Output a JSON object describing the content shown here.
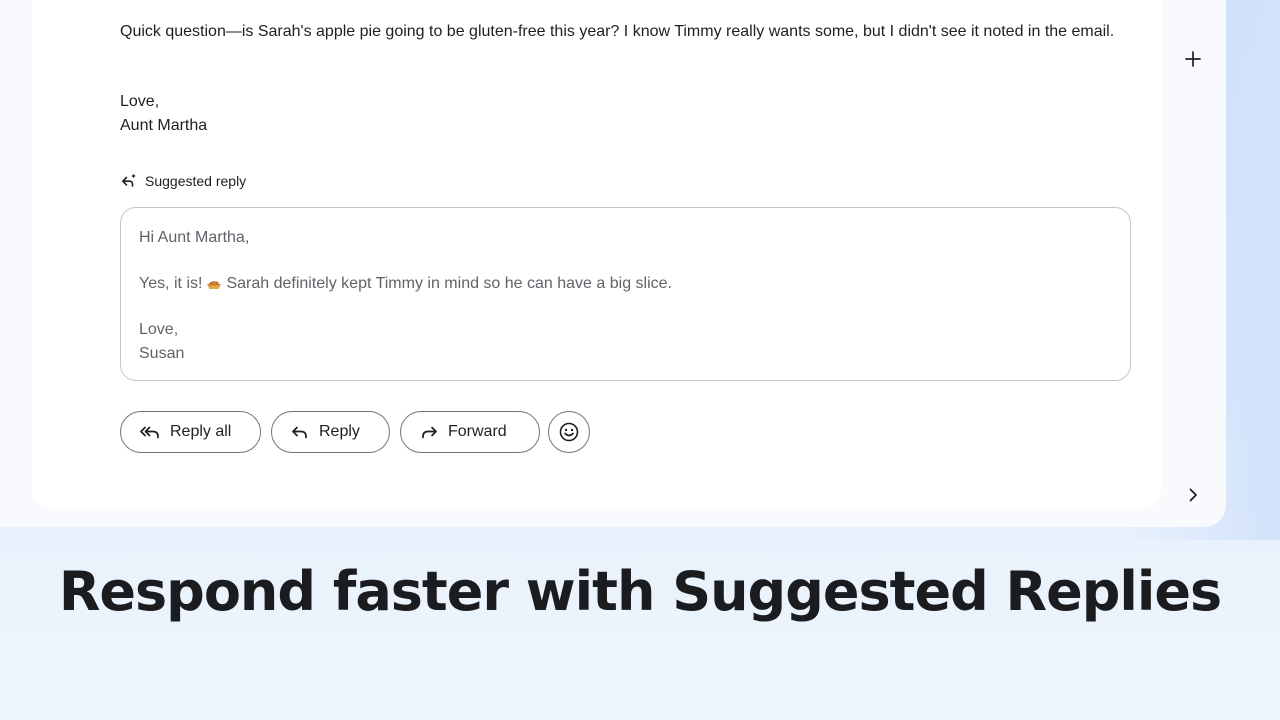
{
  "email": {
    "body_question": "Quick question—is Sarah's apple pie going to be gluten-free this year? I know Timmy really wants some, but I didn't see it noted in the email.",
    "closing": "Love,",
    "signature": "Aunt Martha"
  },
  "suggested_reply": {
    "label": "Suggested reply",
    "label_icon": "sparkle-reply-icon",
    "greeting": "Hi Aunt Martha,",
    "body_before_emoji": "Yes, it is!",
    "emoji": "pie-emoji",
    "body_after_emoji": "Sarah definitely kept Timmy in mind so he can have a big slice.",
    "closing": "Love,",
    "signature": "Susan"
  },
  "actions": {
    "reply_all": "Reply all",
    "reply": "Reply",
    "forward": "Forward",
    "emoji_icon": "smiley-icon"
  },
  "side_panel": {
    "add_icon": "plus-icon",
    "expand_icon": "chevron-right-icon"
  },
  "caption": {
    "headline": "Respond faster with Suggested Replies"
  },
  "colors": {
    "background_top": "#c7def8",
    "background_bottom": "#eef5fd",
    "card": "#ffffff",
    "window": "#f8fafd",
    "suggested_text": "#5f6368",
    "outline": "#747775"
  }
}
